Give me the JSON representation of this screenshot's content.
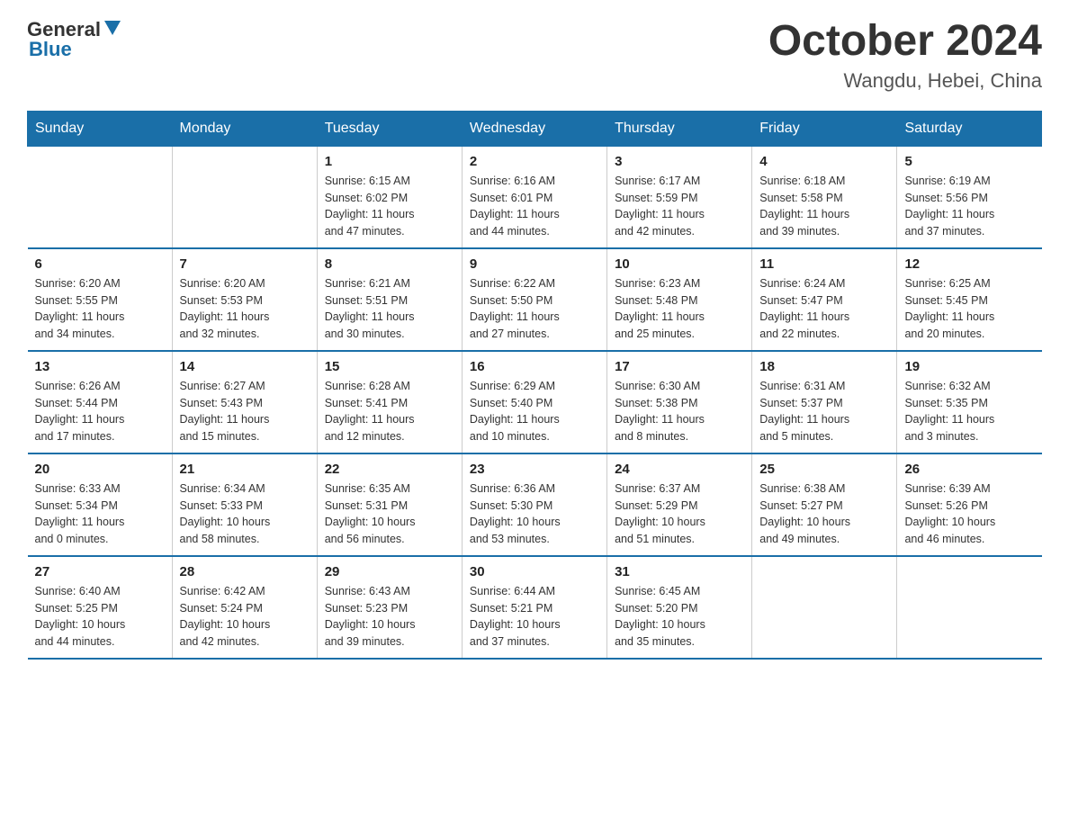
{
  "logo": {
    "general": "General",
    "blue": "Blue"
  },
  "title": "October 2024",
  "location": "Wangdu, Hebei, China",
  "headers": [
    "Sunday",
    "Monday",
    "Tuesday",
    "Wednesday",
    "Thursday",
    "Friday",
    "Saturday"
  ],
  "weeks": [
    [
      {
        "day": "",
        "info": ""
      },
      {
        "day": "",
        "info": ""
      },
      {
        "day": "1",
        "info": "Sunrise: 6:15 AM\nSunset: 6:02 PM\nDaylight: 11 hours\nand 47 minutes."
      },
      {
        "day": "2",
        "info": "Sunrise: 6:16 AM\nSunset: 6:01 PM\nDaylight: 11 hours\nand 44 minutes."
      },
      {
        "day": "3",
        "info": "Sunrise: 6:17 AM\nSunset: 5:59 PM\nDaylight: 11 hours\nand 42 minutes."
      },
      {
        "day": "4",
        "info": "Sunrise: 6:18 AM\nSunset: 5:58 PM\nDaylight: 11 hours\nand 39 minutes."
      },
      {
        "day": "5",
        "info": "Sunrise: 6:19 AM\nSunset: 5:56 PM\nDaylight: 11 hours\nand 37 minutes."
      }
    ],
    [
      {
        "day": "6",
        "info": "Sunrise: 6:20 AM\nSunset: 5:55 PM\nDaylight: 11 hours\nand 34 minutes."
      },
      {
        "day": "7",
        "info": "Sunrise: 6:20 AM\nSunset: 5:53 PM\nDaylight: 11 hours\nand 32 minutes."
      },
      {
        "day": "8",
        "info": "Sunrise: 6:21 AM\nSunset: 5:51 PM\nDaylight: 11 hours\nand 30 minutes."
      },
      {
        "day": "9",
        "info": "Sunrise: 6:22 AM\nSunset: 5:50 PM\nDaylight: 11 hours\nand 27 minutes."
      },
      {
        "day": "10",
        "info": "Sunrise: 6:23 AM\nSunset: 5:48 PM\nDaylight: 11 hours\nand 25 minutes."
      },
      {
        "day": "11",
        "info": "Sunrise: 6:24 AM\nSunset: 5:47 PM\nDaylight: 11 hours\nand 22 minutes."
      },
      {
        "day": "12",
        "info": "Sunrise: 6:25 AM\nSunset: 5:45 PM\nDaylight: 11 hours\nand 20 minutes."
      }
    ],
    [
      {
        "day": "13",
        "info": "Sunrise: 6:26 AM\nSunset: 5:44 PM\nDaylight: 11 hours\nand 17 minutes."
      },
      {
        "day": "14",
        "info": "Sunrise: 6:27 AM\nSunset: 5:43 PM\nDaylight: 11 hours\nand 15 minutes."
      },
      {
        "day": "15",
        "info": "Sunrise: 6:28 AM\nSunset: 5:41 PM\nDaylight: 11 hours\nand 12 minutes."
      },
      {
        "day": "16",
        "info": "Sunrise: 6:29 AM\nSunset: 5:40 PM\nDaylight: 11 hours\nand 10 minutes."
      },
      {
        "day": "17",
        "info": "Sunrise: 6:30 AM\nSunset: 5:38 PM\nDaylight: 11 hours\nand 8 minutes."
      },
      {
        "day": "18",
        "info": "Sunrise: 6:31 AM\nSunset: 5:37 PM\nDaylight: 11 hours\nand 5 minutes."
      },
      {
        "day": "19",
        "info": "Sunrise: 6:32 AM\nSunset: 5:35 PM\nDaylight: 11 hours\nand 3 minutes."
      }
    ],
    [
      {
        "day": "20",
        "info": "Sunrise: 6:33 AM\nSunset: 5:34 PM\nDaylight: 11 hours\nand 0 minutes."
      },
      {
        "day": "21",
        "info": "Sunrise: 6:34 AM\nSunset: 5:33 PM\nDaylight: 10 hours\nand 58 minutes."
      },
      {
        "day": "22",
        "info": "Sunrise: 6:35 AM\nSunset: 5:31 PM\nDaylight: 10 hours\nand 56 minutes."
      },
      {
        "day": "23",
        "info": "Sunrise: 6:36 AM\nSunset: 5:30 PM\nDaylight: 10 hours\nand 53 minutes."
      },
      {
        "day": "24",
        "info": "Sunrise: 6:37 AM\nSunset: 5:29 PM\nDaylight: 10 hours\nand 51 minutes."
      },
      {
        "day": "25",
        "info": "Sunrise: 6:38 AM\nSunset: 5:27 PM\nDaylight: 10 hours\nand 49 minutes."
      },
      {
        "day": "26",
        "info": "Sunrise: 6:39 AM\nSunset: 5:26 PM\nDaylight: 10 hours\nand 46 minutes."
      }
    ],
    [
      {
        "day": "27",
        "info": "Sunrise: 6:40 AM\nSunset: 5:25 PM\nDaylight: 10 hours\nand 44 minutes."
      },
      {
        "day": "28",
        "info": "Sunrise: 6:42 AM\nSunset: 5:24 PM\nDaylight: 10 hours\nand 42 minutes."
      },
      {
        "day": "29",
        "info": "Sunrise: 6:43 AM\nSunset: 5:23 PM\nDaylight: 10 hours\nand 39 minutes."
      },
      {
        "day": "30",
        "info": "Sunrise: 6:44 AM\nSunset: 5:21 PM\nDaylight: 10 hours\nand 37 minutes."
      },
      {
        "day": "31",
        "info": "Sunrise: 6:45 AM\nSunset: 5:20 PM\nDaylight: 10 hours\nand 35 minutes."
      },
      {
        "day": "",
        "info": ""
      },
      {
        "day": "",
        "info": ""
      }
    ]
  ]
}
